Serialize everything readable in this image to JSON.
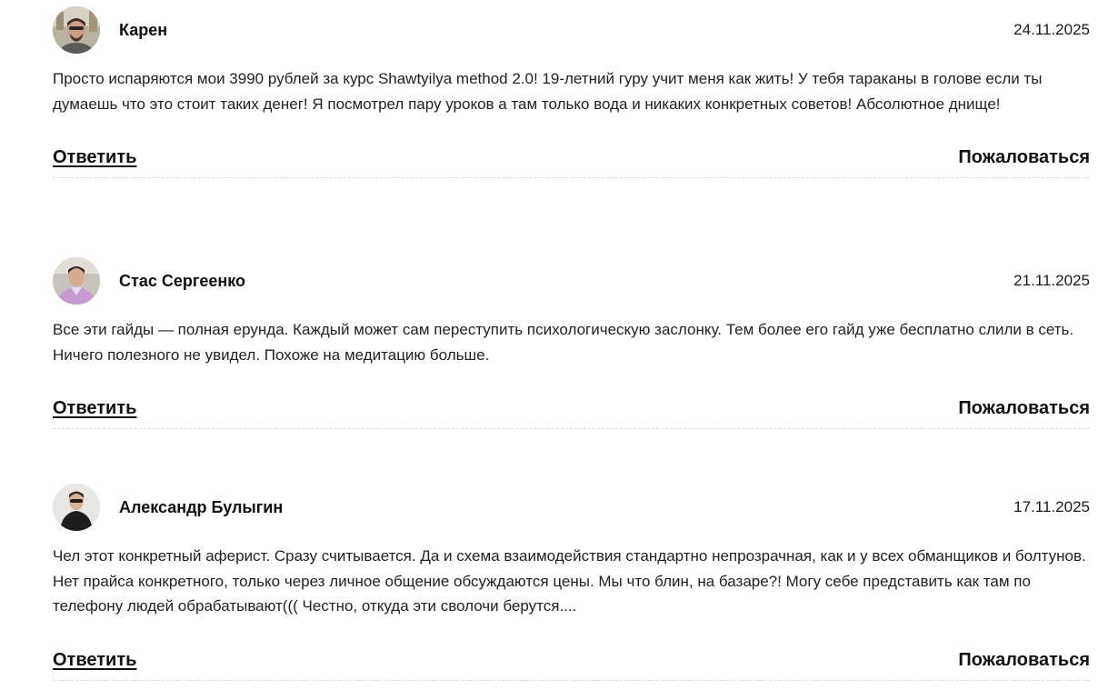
{
  "comments": [
    {
      "author": "Карен",
      "date": "24.11.2025",
      "text": "Просто испаряются мои 3990 рублей за курс Shawtyilya method 2.0! 19-летний гуру учит меня как жить! У тебя тараканы в голове если ты думаешь что это стоит таких денег! Я посмотрел пару уроков а там только вода и никаких конкретных советов! Абсолютное днище!",
      "reply_label": "Ответить",
      "report_label": "Пожаловаться"
    },
    {
      "author": "Стас Сергеенко",
      "date": "21.11.2025",
      "text": "Все эти гайды — полная ерунда. Каждый может сам переступить психологическую заслонку. Тем более его гайд уже бесплатно слили в сеть. Ничего полезного не увидел. Похоже на медитацию больше.",
      "reply_label": "Ответить",
      "report_label": "Пожаловаться"
    },
    {
      "author": "Александр Булыгин",
      "date": "17.11.2025",
      "text": "Чел этот конкретный аферист. Сразу считывается. Да и схема взаимодействия стандартно непрозрачная, как и у всех обманщиков и болтунов. Нет прайса конкретного, только через личное общение обсуждаются цены. Мы что блин, на базаре?! Могу себе представить как там по телефону людей обрабатывают((( Честно, откуда эти сволочи берутся....",
      "reply_label": "Ответить",
      "report_label": "Пожаловаться"
    }
  ]
}
